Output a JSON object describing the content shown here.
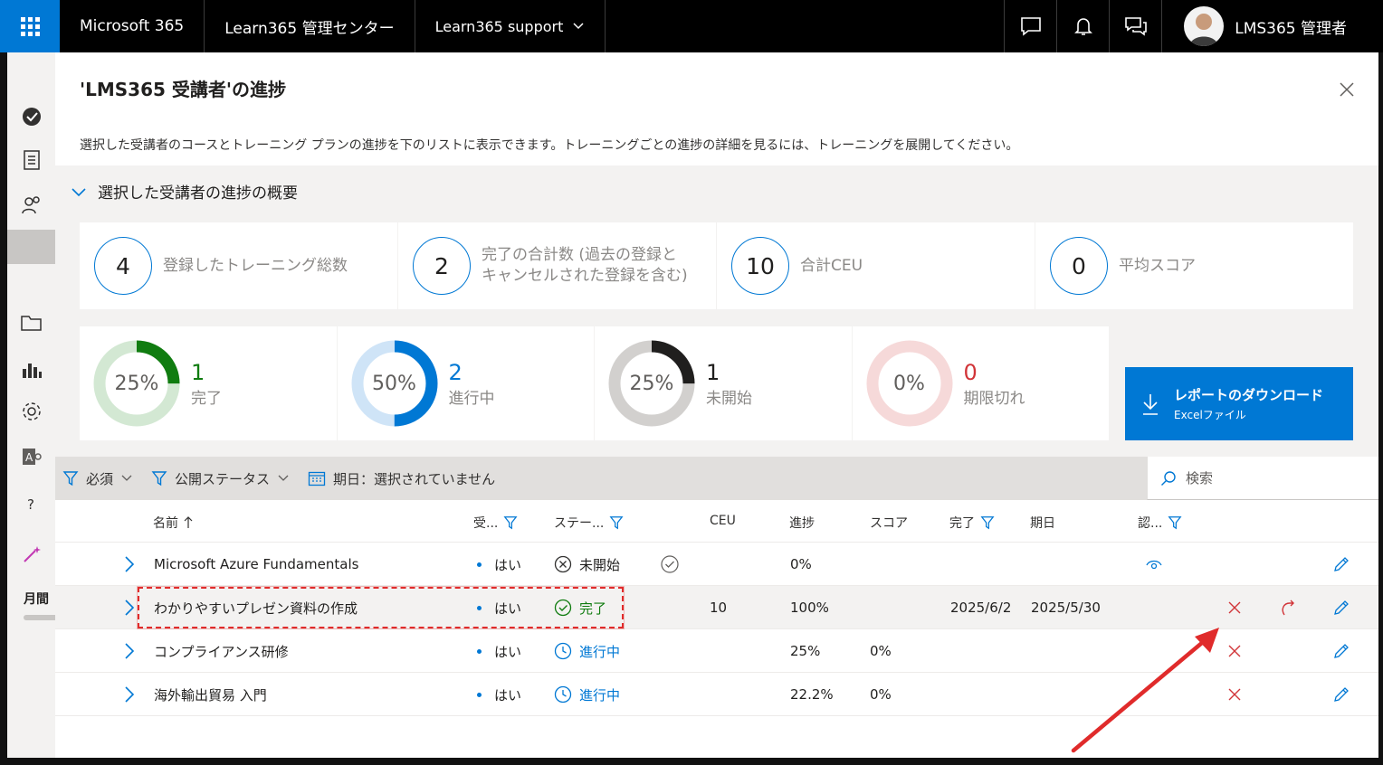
{
  "topbar": {
    "app_name": "Microsoft 365",
    "center_name": "Learn365 管理センター",
    "org_name": "Learn365 support",
    "user_name": "LMS365 管理者"
  },
  "leftnav": {
    "month_label": "月間"
  },
  "panel": {
    "title": "'LMS365 受講者'の進捗",
    "description": "選択した受講者のコースとトレーニング プランの進捗を下のリストに表示できます。トレーニングごとの進捗の詳細を見るには、トレーニングを展開してください。",
    "summary_label": "選択した受講者の進捗の概要"
  },
  "stats": [
    {
      "value": "4",
      "label": "登録したトレーニング総数"
    },
    {
      "value": "2",
      "label": "完了の合計数 (過去の登録と\nキャンセルされた登録を含む)"
    },
    {
      "value": "10",
      "label": "合計CEU"
    },
    {
      "value": "0",
      "label": "平均スコア"
    }
  ],
  "donuts": [
    {
      "pct_label": "25%",
      "fraction": 0.25,
      "count": "1",
      "label": "完了",
      "color": "#107c10",
      "track": "#d3e8d3"
    },
    {
      "pct_label": "50%",
      "fraction": 0.5,
      "count": "2",
      "label": "進行中",
      "color": "#0078d4",
      "track": "#cfe4f7"
    },
    {
      "pct_label": "25%",
      "fraction": 0.25,
      "count": "1",
      "label": "未開始",
      "color": "#201f1e",
      "track": "#d2d0ce"
    },
    {
      "pct_label": "0%",
      "fraction": 0,
      "count": "0",
      "label": "期限切れ",
      "color": "#d13438",
      "track": "#f6d9d9"
    }
  ],
  "download": {
    "title": "レポートのダウンロード",
    "subtitle": "Excelファイル"
  },
  "filters": {
    "required": "必須",
    "publish_status": "公開ステータス",
    "due_date": "期日：選択されていません",
    "search_placeholder": "検索"
  },
  "table": {
    "headers": {
      "name": "名前",
      "received": "受...",
      "status": "ステー...",
      "ceu": "CEU",
      "progress": "進捗",
      "score": "スコア",
      "completed": "完了",
      "due": "期日",
      "cert": "認..."
    },
    "rows": [
      {
        "name": "Microsoft Azure Fundamentals",
        "required": "はい",
        "status": "未開始",
        "ceu": "",
        "progress": "0%",
        "score": "",
        "completed": "",
        "due": ""
      },
      {
        "name": "わかりやすいプレゼン資料の作成",
        "required": "はい",
        "status": "完了",
        "ceu": "10",
        "progress": "100%",
        "score": "",
        "completed": "2025/6/2",
        "due": "2025/5/30"
      },
      {
        "name": "コンプライアンス研修",
        "required": "はい",
        "status": "進行中",
        "ceu": "",
        "progress": "25%",
        "score": "0%",
        "completed": "",
        "due": ""
      },
      {
        "name": "海外輸出貿易 入門",
        "required": "はい",
        "status": "進行中",
        "ceu": "",
        "progress": "22.2%",
        "score": "0%",
        "completed": "",
        "due": ""
      }
    ]
  },
  "colors": {
    "accent": "#0078d4",
    "success": "#107c10",
    "danger": "#d13438",
    "annotation": "#e02b2b"
  }
}
